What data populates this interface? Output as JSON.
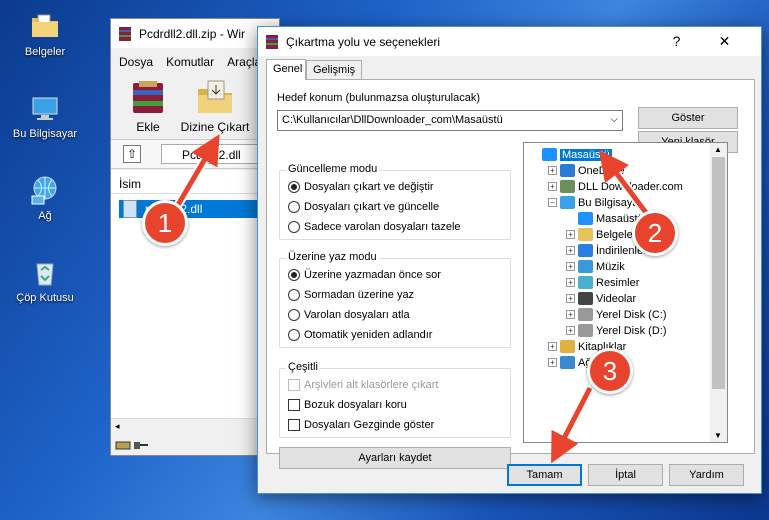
{
  "desktop": {
    "icons": [
      {
        "label": "Belgeler",
        "icon": "documents-folder-icon"
      },
      {
        "label": "Bu Bilgisayar",
        "icon": "this-pc-icon"
      },
      {
        "label": "Ağ",
        "icon": "network-icon"
      },
      {
        "label": "Çöp Kutusu",
        "icon": "recycle-bin-icon"
      }
    ]
  },
  "winrar": {
    "title": "Pcdrdll2.dll.zip - Wir",
    "menu": [
      "Dosya",
      "Komutlar",
      "Araçla"
    ],
    "toolbar": {
      "add": "Ekle",
      "extract": "Dizine Çıkart"
    },
    "path": "Pcdrdll2.dll",
    "column_name": "İsim",
    "file": "pcdrdll2.dll"
  },
  "dialog": {
    "title": "Çıkartma yolu ve seçenekleri",
    "help_btn": "?",
    "close_btn": "✕",
    "tabs": [
      "Genel",
      "Gelişmiş"
    ],
    "dest_label": "Hedef konum (bulunmazsa oluşturulacak)",
    "dest_value": "C:\\Kullanıcılar\\DllDownloader_com\\Masaüstü",
    "show_btn": "Göster",
    "new_folder_btn": "Yeni klasör",
    "update_mode": {
      "legend": "Güncelleme modu",
      "options": [
        "Dosyaları çıkart ve değiştir",
        "Dosyaları çıkart ve güncelle",
        "Sadece varolan dosyaları tazele"
      ],
      "selected": 0
    },
    "overwrite_mode": {
      "legend": "Üzerine yaz modu",
      "options": [
        "Üzerine yazmadan önce sor",
        "Sormadan üzerine yaz",
        "Varolan dosyaları atla",
        "Otomatik yeniden adlandır"
      ],
      "selected": 0
    },
    "misc": {
      "legend": "Çeşitli",
      "options": [
        "Arşivleri alt klasörlere çıkart",
        "Bozuk dosyaları koru",
        "Dosyaları Gezginde göster"
      ]
    },
    "save_settings_btn": "Ayarları kaydet",
    "tree": [
      {
        "label": "Masaüstü",
        "level": 0,
        "selected": true,
        "expander": "",
        "icon": "desktop-icon"
      },
      {
        "label": "OneDrive",
        "level": 1,
        "expander": "+",
        "icon": "onedrive-icon"
      },
      {
        "label": "DLL Downloader.com",
        "level": 1,
        "expander": "+",
        "icon": "user-icon"
      },
      {
        "label": "Bu Bilgisayar",
        "level": 1,
        "expander": "−",
        "icon": "this-pc-icon"
      },
      {
        "label": "Masaüstü",
        "level": 2,
        "expander": "",
        "icon": "desktop-icon"
      },
      {
        "label": "Belgeler",
        "level": 2,
        "expander": "+",
        "icon": "documents-icon"
      },
      {
        "label": "İndirilenler",
        "level": 2,
        "expander": "+",
        "icon": "downloads-icon"
      },
      {
        "label": "Müzik",
        "level": 2,
        "expander": "+",
        "icon": "music-icon"
      },
      {
        "label": "Resimler",
        "level": 2,
        "expander": "+",
        "icon": "pictures-icon"
      },
      {
        "label": "Videolar",
        "level": 2,
        "expander": "+",
        "icon": "videos-icon"
      },
      {
        "label": "Yerel Disk (C:)",
        "level": 2,
        "expander": "+",
        "icon": "drive-icon"
      },
      {
        "label": "Yerel Disk (D:)",
        "level": 2,
        "expander": "+",
        "icon": "drive-icon"
      },
      {
        "label": "Kitaplıklar",
        "level": 1,
        "expander": "+",
        "icon": "libraries-icon"
      },
      {
        "label": "Ağ",
        "level": 1,
        "expander": "+",
        "icon": "network-icon"
      }
    ],
    "ok_btn": "Tamam",
    "cancel_btn": "İptal",
    "help_btn2": "Yardım"
  },
  "annotations": [
    "1",
    "2",
    "3"
  ],
  "colors": {
    "accent": "#0078d7",
    "badge": "#e8432c"
  }
}
